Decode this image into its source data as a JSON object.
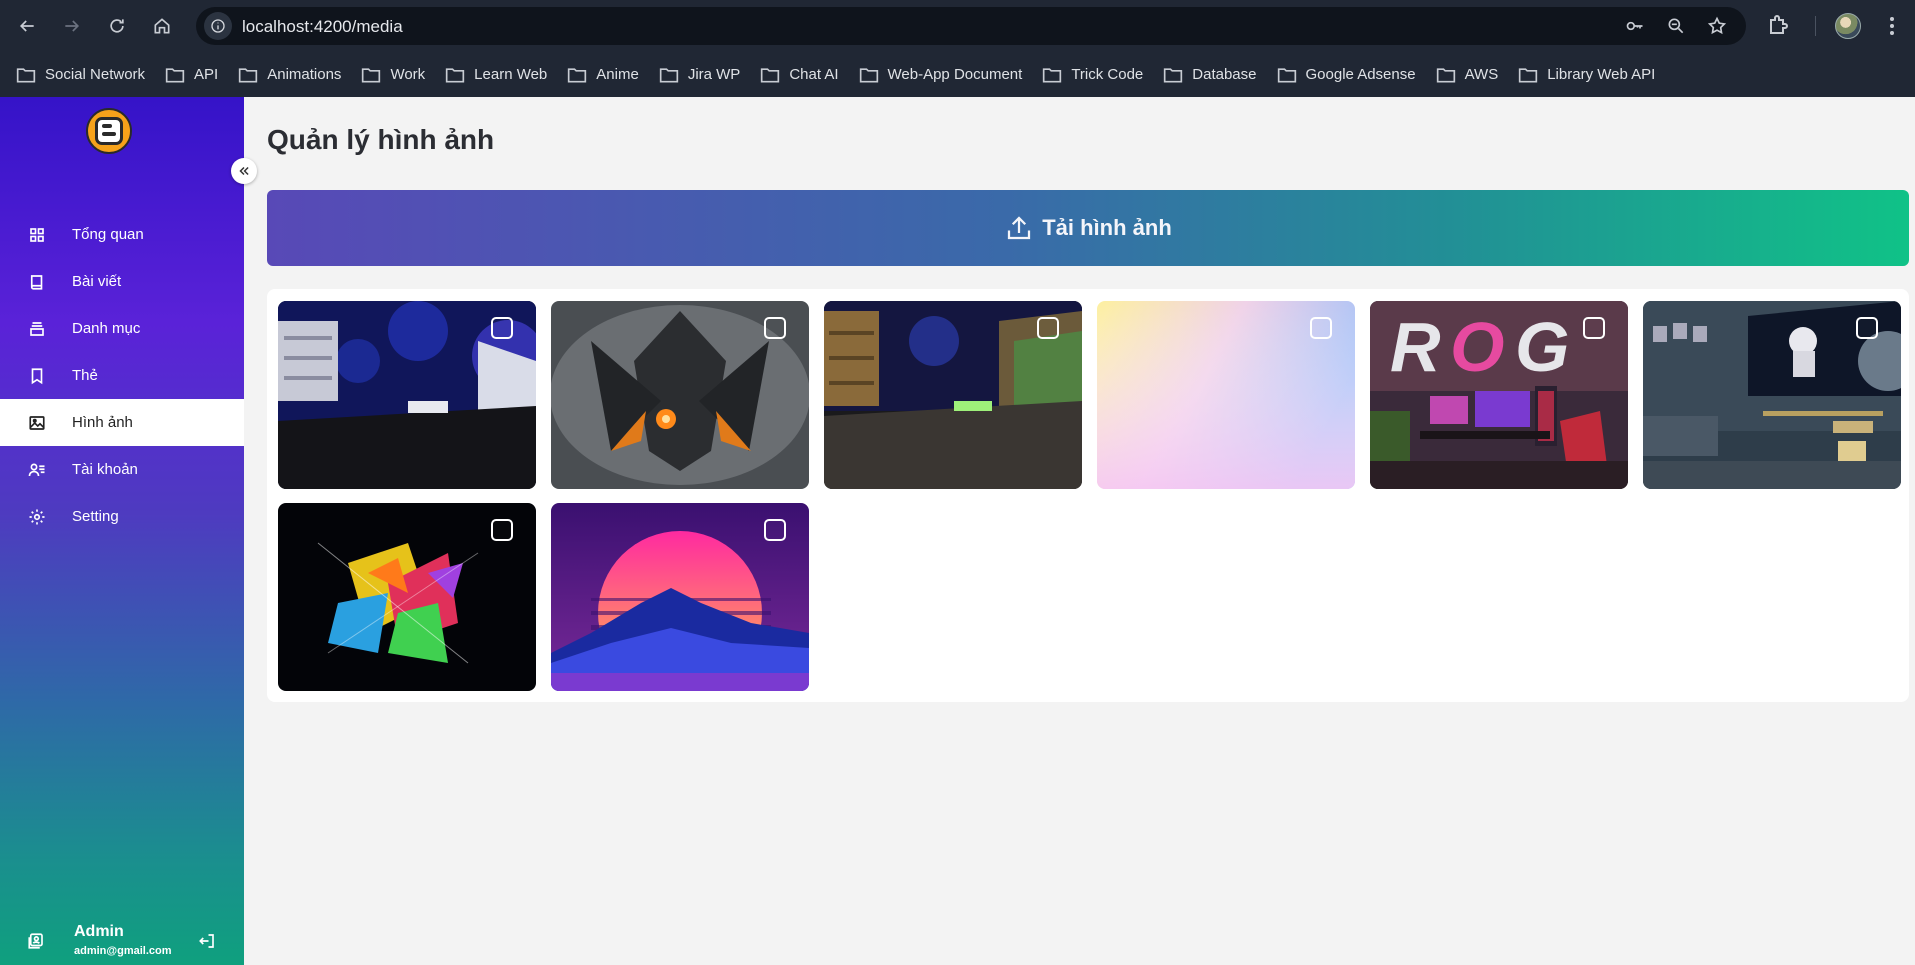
{
  "browser": {
    "url": "localhost:4200/media",
    "bookmarks": [
      {
        "label": "Social Network"
      },
      {
        "label": "API"
      },
      {
        "label": "Animations"
      },
      {
        "label": "Work"
      },
      {
        "label": "Learn Web"
      },
      {
        "label": "Anime"
      },
      {
        "label": "Jira WP"
      },
      {
        "label": "Chat AI"
      },
      {
        "label": "Web-App Document"
      },
      {
        "label": "Trick Code"
      },
      {
        "label": "Database"
      },
      {
        "label": "Google Adsense"
      },
      {
        "label": "AWS"
      },
      {
        "label": "Library Web API"
      }
    ]
  },
  "sidebar": {
    "items": [
      {
        "label": "Tổng quan",
        "icon": "dashboard-grid-icon"
      },
      {
        "label": "Bài viết",
        "icon": "book-icon"
      },
      {
        "label": "Danh mục",
        "icon": "stack-icon"
      },
      {
        "label": "Thẻ",
        "icon": "bookmark-icon"
      },
      {
        "label": "Hình ảnh",
        "icon": "image-icon",
        "active": true
      },
      {
        "label": "Tài khoản",
        "icon": "user-list-icon"
      },
      {
        "label": "Setting",
        "icon": "gear-icon"
      }
    ],
    "user": {
      "name": "Admin",
      "email": "admin@gmail.com"
    },
    "colors": {
      "top": "#3513c8",
      "bottom": "#0fa07e"
    }
  },
  "main": {
    "title": "Quản lý hình ảnh",
    "upload_label": "Tải hình ảnh",
    "upload_colors": {
      "start": "#5849b7",
      "end": "#10c287"
    },
    "images": [
      {
        "subject": "blue-neon-room",
        "selected": false
      },
      {
        "subject": "dark-warrior-art",
        "selected": false
      },
      {
        "subject": "neon-desk-room",
        "selected": false
      },
      {
        "subject": "pastel-gradient",
        "selected": false
      },
      {
        "subject": "rog-gaming-setup",
        "selected": false
      },
      {
        "subject": "astronaut-room",
        "selected": false
      },
      {
        "subject": "abstract-color-explosion",
        "selected": false
      },
      {
        "subject": "synthwave-sunset",
        "selected": false
      }
    ]
  }
}
